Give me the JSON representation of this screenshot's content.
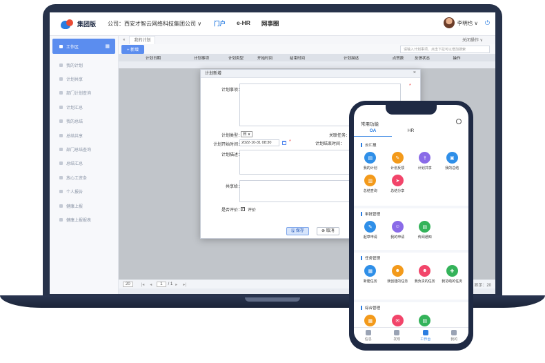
{
  "app": {
    "logo_text": "集团版",
    "company": "公司：西安才智云网络科技集团公司 ∨"
  },
  "nav": [
    "门户",
    "e-HR",
    "网事圈"
  ],
  "user": {
    "name": "李明也 ∨"
  },
  "sidebar": {
    "active": "工作区",
    "items": [
      "我的计划",
      "计划共享",
      "部门计划查询",
      "计划汇总",
      "我的总结",
      "总结共享",
      "部门总结查询",
      "总结汇总",
      "放心工资条",
      "个人报告",
      "健康上报",
      "健康上报报表"
    ]
  },
  "tabs": {
    "current": "我的计划",
    "right": "关闭操作 ∨"
  },
  "toolbar": {
    "new_label": "+ 新增",
    "search_placeholder": "请输入计划事项、点击下拉可以增加搜索"
  },
  "table": {
    "headers": [
      "计划日期",
      "计划事项",
      "计划类型",
      "开始时间",
      "结束时间",
      "计划描述",
      "点赞数",
      "反馈状态",
      "操作"
    ]
  },
  "pager": {
    "page_size": "20",
    "page": "1",
    "total_pages": "/ 1",
    "summary": "显示：20"
  },
  "dialog": {
    "title": "计划新增",
    "close": "×",
    "field_item": "计划事项：",
    "field_type": "计划类型：",
    "type_value": "日 ∨",
    "field_related": "关联任务：",
    "field_start": "计划开始时间：",
    "start_value": "2022-10-31 08:30",
    "field_end": "计划结束时间：",
    "field_desc": "计划描述：",
    "field_share": "共享给：",
    "field_comment": "是否评价：",
    "comment_option": "评价",
    "save": "保存",
    "cancel": "取消"
  },
  "phone": {
    "title": "常用功能",
    "tabs": [
      "OA",
      "HR"
    ],
    "sections": [
      {
        "title": "云汇报",
        "apps": [
          {
            "label": "我的计划",
            "color": "#2f8fe8"
          },
          {
            "label": "计划反馈",
            "color": "#f39a1b"
          },
          {
            "label": "计划共享",
            "color": "#8a6be8"
          },
          {
            "label": "我的总结",
            "color": "#2f8fe8"
          },
          {
            "label": "总结查询",
            "color": "#f39a1b"
          },
          {
            "label": "总结分享",
            "color": "#f2456a"
          }
        ]
      },
      {
        "title": "审批管理",
        "apps": [
          {
            "label": "起草申请",
            "color": "#2f8fe8"
          },
          {
            "label": "我的申请",
            "color": "#8a6be8"
          },
          {
            "label": "传阅通知",
            "color": "#34b35a"
          }
        ]
      },
      {
        "title": "任务管理",
        "apps": [
          {
            "label": "新建任务",
            "color": "#2f8fe8"
          },
          {
            "label": "我创建的任务",
            "color": "#f39a1b"
          },
          {
            "label": "我负责的任务",
            "color": "#f2456a"
          },
          {
            "label": "我协助的任务",
            "color": "#34b35a"
          }
        ]
      },
      {
        "title": "综合管理",
        "apps": [
          {
            "label": "",
            "color": "#f39a1b"
          },
          {
            "label": "",
            "color": "#f2456a"
          },
          {
            "label": "",
            "color": "#34b35a"
          }
        ]
      }
    ],
    "footer": [
      "信息",
      "发现",
      "工作台",
      "我的"
    ]
  }
}
